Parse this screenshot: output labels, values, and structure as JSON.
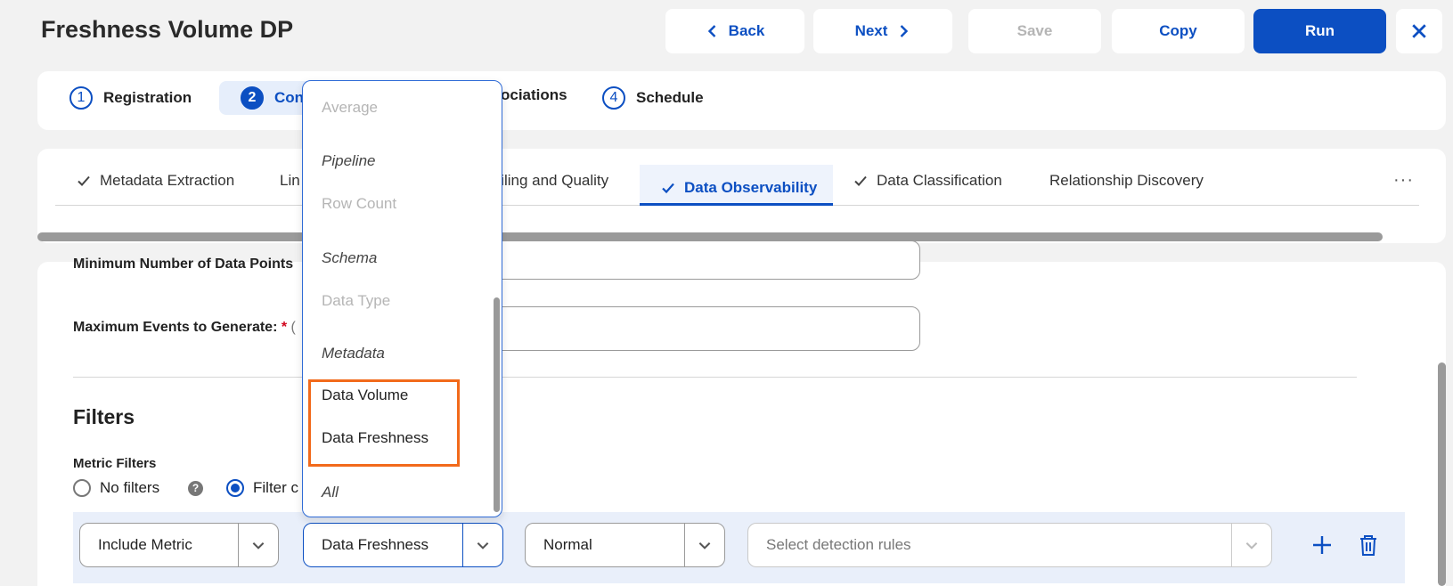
{
  "page": {
    "title": "Freshness Volume DP"
  },
  "toolbar": {
    "back_label": "Back",
    "next_label": "Next",
    "save_label": "Save",
    "copy_label": "Copy",
    "run_label": "Run"
  },
  "stepper": [
    {
      "num": "1",
      "label": "Registration"
    },
    {
      "num": "2",
      "label": "Con"
    },
    {
      "num": "",
      "label": "ociations"
    },
    {
      "num": "4",
      "label": "Schedule"
    }
  ],
  "tabs": [
    {
      "label": "Metadata Extraction",
      "checked": true
    },
    {
      "label": "Lin",
      "checked": false
    },
    {
      "label": "ofiling and Quality",
      "checked": false
    },
    {
      "label": "Data Observability",
      "checked": true,
      "active": true
    },
    {
      "label": "Data Classification",
      "checked": true
    },
    {
      "label": "Relationship Discovery",
      "checked": false
    }
  ],
  "form": {
    "min_points_label": "Minimum Number of Data Points",
    "max_events_label": "Maximum Events to Generate:",
    "max_events_extra": "(",
    "required_mark": "*"
  },
  "filters": {
    "title": "Filters",
    "metric_filters_label": "Metric Filters",
    "no_filters_label": "No filters",
    "filter_option_label": "Filter c",
    "help_glyph": "?",
    "row": {
      "include_value": "Include Metric",
      "metric_value": "Data Freshness",
      "severity_value": "Normal",
      "detection_placeholder": "Select detection rules"
    }
  },
  "dropdown": {
    "items": [
      {
        "label": "Average",
        "kind": "disabled"
      },
      {
        "label": "Pipeline",
        "kind": "group"
      },
      {
        "label": "Row Count",
        "kind": "disabled"
      },
      {
        "label": "Schema",
        "kind": "group"
      },
      {
        "label": "Data Type",
        "kind": "disabled"
      },
      {
        "label": "Metadata",
        "kind": "group"
      },
      {
        "label": "Data Volume",
        "kind": "option"
      },
      {
        "label": "Data Freshness",
        "kind": "option"
      },
      {
        "label": "All",
        "kind": "group"
      }
    ]
  },
  "colors": {
    "accent": "#0c4fc2",
    "highlight": "#f26a1b",
    "filter_row_bg": "#e9effa"
  }
}
